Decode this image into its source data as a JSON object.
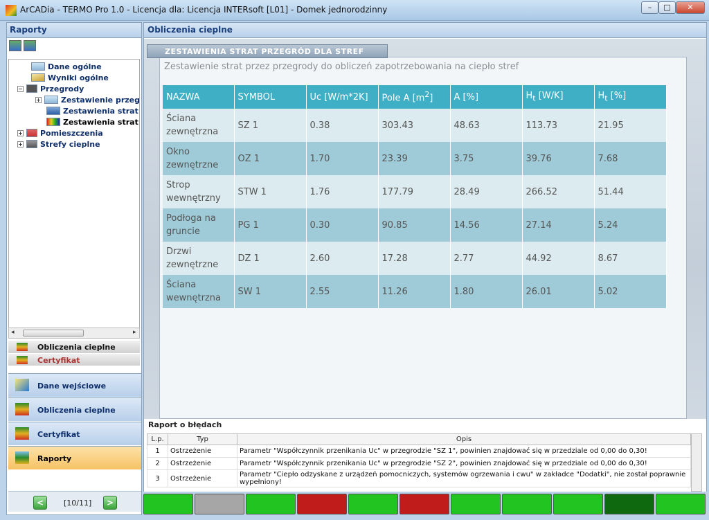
{
  "window": {
    "title": "ArCADia - TERMO Pro 1.0 - Licencja dla: Licencja INTERsoft [L01] - Domek jednorodzinny",
    "min_label": "–",
    "max_label": "□",
    "close_label": "✕"
  },
  "left": {
    "header": "Raporty",
    "tree": [
      {
        "label": "Dane ogólne"
      },
      {
        "label": "Wyniki ogólne"
      },
      {
        "label": "Przegrody"
      },
      {
        "label": "Zestawienie przegr"
      },
      {
        "label": "Zestawienia strat p"
      },
      {
        "label": "Zestawienia strat p"
      },
      {
        "label": "Pomieszczenia"
      },
      {
        "label": "Strefy cieplne"
      }
    ],
    "mini_items": [
      "Obliczenia cieplne",
      "Certyfikat"
    ],
    "big_items": [
      "Dane wejściowe",
      "Obliczenia cieplne",
      "Certyfikat",
      "Raporty"
    ],
    "pager": {
      "prev": "<",
      "text": "[10/11]",
      "next": ">"
    }
  },
  "main": {
    "header": "Obliczenia cieplne",
    "section_title": "ZESTAWIENIA STRAT PRZEGRÓD DLA STREF",
    "subtitle": "Zestawienie strat przez przegrody do obliczeń zapotrzebowania na ciepło stref",
    "table": {
      "headers": [
        "NAZWA",
        "SYMBOL",
        "Uc [W/m*2K]",
        "Pole A [m",
        "2",
        "]",
        "A [%]",
        "H",
        "t",
        " [W/K]",
        "H",
        "t",
        " [%]"
      ],
      "rows": [
        {
          "name": "Ściana zewnętrzna",
          "symbol": "SZ 1",
          "uc": "0.38",
          "pole": "303.43",
          "a": "48.63",
          "ht": "113.73",
          "htp": "21.95"
        },
        {
          "name": "Okno zewnętrzne",
          "symbol": "OZ 1",
          "uc": "1.70",
          "pole": "23.39",
          "a": "3.75",
          "ht": "39.76",
          "htp": "7.68"
        },
        {
          "name": "Strop wewnętrzny",
          "symbol": "STW 1",
          "uc": "1.76",
          "pole": "177.79",
          "a": "28.49",
          "ht": "266.52",
          "htp": "51.44"
        },
        {
          "name": "Podłoga na gruncie",
          "symbol": "PG 1",
          "uc": "0.30",
          "pole": "90.85",
          "a": "14.56",
          "ht": "27.14",
          "htp": "5.24"
        },
        {
          "name": "Drzwi zewnętrzne",
          "symbol": "DZ 1",
          "uc": "2.60",
          "pole": "17.28",
          "a": "2.77",
          "ht": "44.92",
          "htp": "8.67"
        },
        {
          "name": "Ściana wewnętrzna",
          "symbol": "SW 1",
          "uc": "2.55",
          "pole": "11.26",
          "a": "1.80",
          "ht": "26.01",
          "htp": "5.02"
        }
      ]
    }
  },
  "errors": {
    "title": "Raport o błędach",
    "headers": [
      "L.p.",
      "Typ",
      "Opis"
    ],
    "rows": [
      {
        "lp": "1",
        "typ": "Ostrzeżenie",
        "opis": "Parametr \"Współczynnik przenikania Uc\" w przegrodzie \"SZ 1\", powinien znajdować się w przedziale od 0,00 do 0,30!"
      },
      {
        "lp": "2",
        "typ": "Ostrzeżenie",
        "opis": "Parametr \"Współczynnik przenikania Uc\" w przegrodzie \"SZ 2\", powinien znajdować się w przedziale od 0,00 do 0,30!"
      },
      {
        "lp": "3",
        "typ": "Ostrzeżenie",
        "opis": "Parametr \"Ciepło odzyskane z urządzeń pomocniczych, systemów ogrzewania i cwu\" w zakładce \"Dodatki\", nie został poprawnie wypełniony!"
      }
    ]
  },
  "status_colors": [
    "#21c421",
    "#a6a6a6",
    "#21c421",
    "#c01c1c",
    "#21c421",
    "#c01c1c",
    "#21c421",
    "#21c421",
    "#21c421",
    "#0f6a0f",
    "#21c421"
  ]
}
